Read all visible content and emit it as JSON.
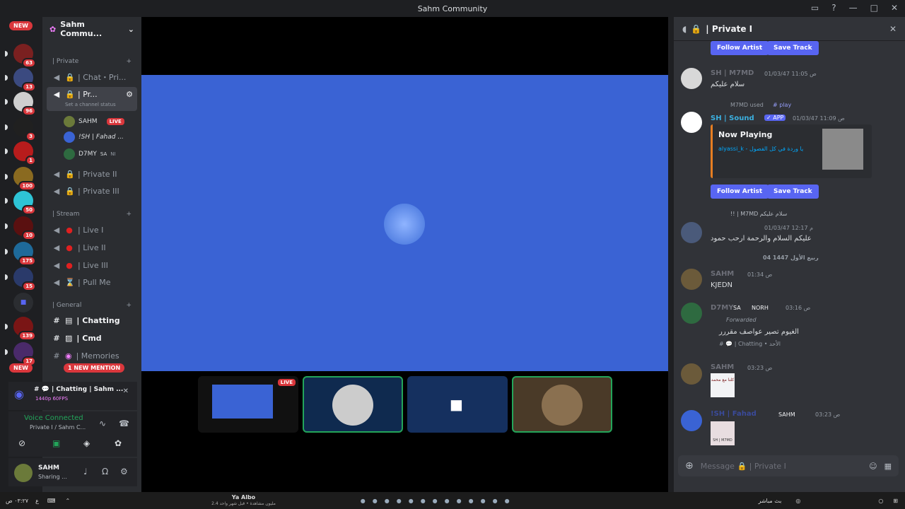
{
  "title": "Sahm Community",
  "servers": [
    {
      "badge": "63"
    },
    {
      "badge": "13"
    },
    {
      "badge": "96"
    },
    {
      "badge": "3"
    },
    {
      "badge": "1"
    },
    {
      "badge": "100"
    },
    {
      "badge": "50"
    },
    {
      "badge": "10"
    },
    {
      "badge": "175"
    },
    {
      "badge": "15"
    },
    {
      "badge": ""
    },
    {
      "badge": "139"
    },
    {
      "badge": "17"
    }
  ],
  "new_pill": "NEW",
  "guild_name": "Sahm Commu...",
  "categories": {
    "private": "| Private",
    "stream": "| Stream",
    "general": "| General"
  },
  "channels": {
    "chat_private": "| Chat・Pri...",
    "private_active": "| Pr...",
    "channel_status": "Set a channel status",
    "private_ii": "| Private II",
    "private_iii": "| Private III",
    "live_i": "| Live I",
    "live_ii": "| Live II",
    "live_iii": "| Live III",
    "pull_me": "| Pull Me",
    "chatting": "| Chatting",
    "cmd": "| Cmd",
    "memories": "| Memories"
  },
  "voice_users": [
    {
      "name": "SAHM",
      "live": "LIVE"
    },
    {
      "name": "!SH | Fahad ...",
      "live": ""
    },
    {
      "name": "D7MY",
      "tag": "SA",
      "extra": "NI"
    }
  ],
  "mention_pill": "1 NEW MENTION",
  "stream_panel": {
    "title": "# 💬 | Chatting | Sahm ...",
    "quality": "1440p 60FPS"
  },
  "voice_panel": {
    "status": "Voice Connected",
    "channel": "Private I / Sahm C..."
  },
  "user_panel": {
    "name": "SAHM",
    "status": "Sharing ..."
  },
  "tile_live": "LIVE",
  "chat": {
    "channel": "| Private I",
    "follow": "Follow Artist",
    "save": "Save Track",
    "m1_name": "SH | M7MD",
    "m1_time": "01/03/47 11:05 ص",
    "m1_text": "سلام عليكم",
    "m2_used": "M7MD used",
    "m2_cmd": "# play",
    "m2_name": "SH | Sound",
    "m2_app": "✓ APP",
    "m2_time": "01/03/47 11:09 ص",
    "now_playing": "Now Playing",
    "track": "alyassi_k - يا وردة في كل الفصول",
    "m3_reply": "!! | M7MD سلام عليكم",
    "m3_time": "01/03/47 12:17 م",
    "m3_text": "عليكم السلام والرحمة ارحب حمود",
    "divider": "04 ربيع الأول 1447",
    "m4_name": "SAHM",
    "m4_time": "01:34 ص",
    "m4_text": "KJEDN",
    "m5_name": "D7MY",
    "m5_tag": "SA",
    "m5_role": "NORH",
    "m5_time": "03:16 ص",
    "m5_fwd": "Forwarded",
    "m5_text": "الغيوم تصير عواصف مقررر",
    "m5_src": "# 💬 | Chatting • الأحد",
    "m6_name": "SAHM",
    "m6_time": "03:23 ص",
    "m6_img": "كلنا مع محمد",
    "m7_name": "!SH | Fahad",
    "m7_role": "SAHM",
    "m7_time": "03:23 ص",
    "m7_img": "SH | M7MD",
    "placeholder": "Message 🔒 | Private I"
  },
  "taskbar": {
    "time": "٠٣:٢٧ ص",
    "lang": "ع",
    "song": "Ya Albo",
    "song_sub": "2.4 مليون مشاهدة • قبل شهر واحد",
    "weather": "بث مباشر"
  }
}
